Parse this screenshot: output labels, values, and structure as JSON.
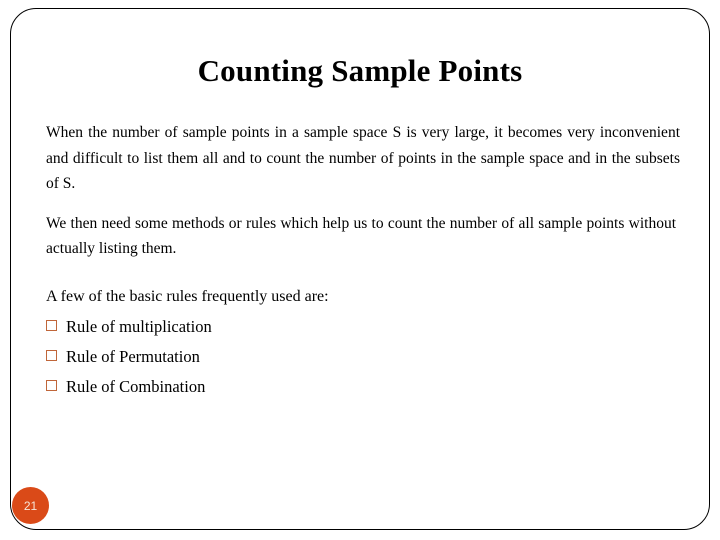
{
  "slide": {
    "title": "Counting Sample Points",
    "paragraphs": [
      "When the number of sample points in a sample space S is very large, it becomes very inconvenient and difficult to list them all and to count the number of points in the sample space and in the subsets of S.",
      "We then need some methods or rules which help us to count the number of all sample points without actually listing them."
    ],
    "list_intro": "A few of the basic rules frequently used are:",
    "bullets": [
      {
        "label": "Rule of multiplication"
      },
      {
        "label": "Rule of Permutation"
      },
      {
        "label": "Rule of Combination"
      }
    ],
    "page_number": "21",
    "colors": {
      "background": "#ffffff",
      "text": "#000000",
      "frame_border": "#000000",
      "bullet_marker": "#C0663A",
      "page_badge_fill": "#DA4A18",
      "page_badge_text": "#F6E6D8"
    }
  }
}
